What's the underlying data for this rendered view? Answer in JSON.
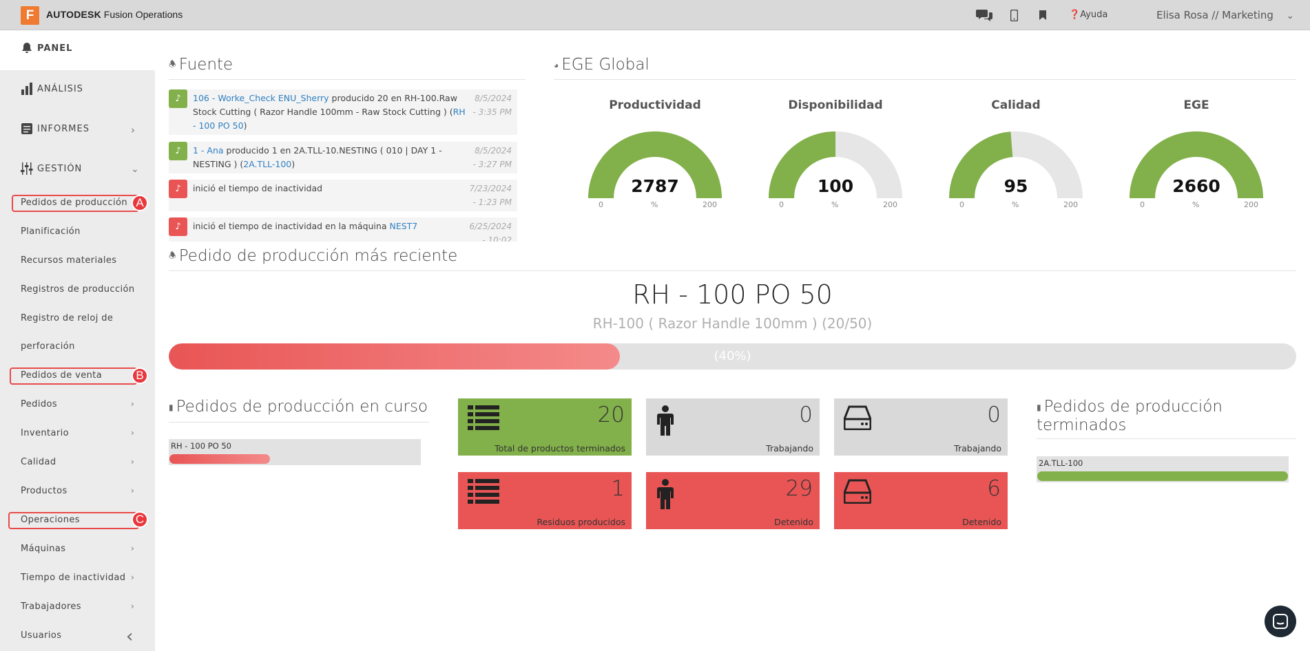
{
  "topbar": {
    "logo_letter": "F",
    "brand_bold": "AUTODESK",
    "brand_rest": "Fusion Operations",
    "help": "Ayuda",
    "user": "Elisa Rosa // Marketing",
    "icons": [
      "chat-icon",
      "mobile-icon",
      "bookmark-icon",
      "help-icon",
      "chevron-down-icon"
    ]
  },
  "sidebar": {
    "panel": "PANEL",
    "analisis": "ANÁLISIS",
    "informes": "INFORMES",
    "gestion": "GESTIÓN",
    "items": [
      {
        "label": "Pedidos de producción",
        "chevron": false
      },
      {
        "label": "Planificación",
        "chevron": false
      },
      {
        "label": "Recursos materiales",
        "chevron": false
      },
      {
        "label": "Registros de producción",
        "chevron": false
      },
      {
        "label": "Registro de reloj de",
        "chevron": false
      },
      {
        "label": "perforación",
        "chevron": false
      },
      {
        "label": "Pedidos de venta",
        "chevron": false
      },
      {
        "label": "Pedidos",
        "chevron": true
      },
      {
        "label": "Inventario",
        "chevron": true
      },
      {
        "label": "Calidad",
        "chevron": true
      },
      {
        "label": "Productos",
        "chevron": true
      },
      {
        "label": "Operaciones",
        "chevron": false
      },
      {
        "label": "Máquinas",
        "chevron": true
      },
      {
        "label": "Tiempo de inactividad",
        "chevron": true
      },
      {
        "label": "Trabajadores",
        "chevron": true
      },
      {
        "label": "Usuarios",
        "chevron": false
      }
    ],
    "badges": [
      "A",
      "B",
      "C"
    ]
  },
  "feed": {
    "title": "Fuente",
    "items": [
      {
        "status": "green",
        "link1": "106 - Worke_Check ENU_Sherry",
        "text1": " producido 20 en RH-100.Raw Stock Cutting ( Razor Handle 100mm - Raw Stock Cutting ) (",
        "link2": "RH - 100 PO 50",
        "text2": ")",
        "date": "8/5/2024",
        "time": "- 3:35 PM"
      },
      {
        "status": "green",
        "link1": "1 - Ana",
        "text1": " producido 1 en 2A.TLL-10.NESTING ( 010 | DAY 1 - NESTING ) (",
        "link2": "2A.TLL-100",
        "text2": ")",
        "date": "8/5/2024",
        "time": "- 3:27 PM"
      },
      {
        "status": "red",
        "link1": "",
        "text1": "inició el tiempo de inactividad",
        "link2": "",
        "text2": "",
        "date": "7/23/2024",
        "time": "- 1:23 PM"
      },
      {
        "status": "red",
        "link1": "",
        "text1": "inició el tiempo de inactividad en la máquina ",
        "link2": "NEST7",
        "text2": "",
        "date": "6/25/2024",
        "time": "- 10:02"
      }
    ]
  },
  "oee": {
    "title": "EGE Global",
    "gauges": [
      {
        "title": "Productividad",
        "value": "2787",
        "fill": 1.0,
        "min": "0",
        "max": "200",
        "unit": "%"
      },
      {
        "title": "Disponibilidad",
        "value": "100",
        "fill": 0.5,
        "min": "0",
        "max": "200",
        "unit": "%"
      },
      {
        "title": "Calidad",
        "value": "95",
        "fill": 0.475,
        "min": "0",
        "max": "200",
        "unit": "%"
      },
      {
        "title": "EGE",
        "value": "2660",
        "fill": 1.0,
        "min": "0",
        "max": "200",
        "unit": "%"
      }
    ]
  },
  "recent": {
    "title": "Pedido de producción más reciente",
    "code": "RH - 100 PO 50",
    "desc": "RH-100 ( Razor Handle 100mm ) (20/50)",
    "progress": 0.4,
    "progress_label": "(40%)"
  },
  "in_progress": {
    "title": "Pedidos de producción en curso",
    "items": [
      {
        "label": "RH - 100 PO 50",
        "progress": 0.4
      }
    ]
  },
  "tiles": [
    {
      "value": "20",
      "caption": "Total de productos terminados",
      "color": "#82b04a",
      "icon": "list-icon"
    },
    {
      "value": "0",
      "caption": "Trabajando",
      "color": "#d9d9d9",
      "icon": "person-icon"
    },
    {
      "value": "0",
      "caption": "Trabajando",
      "color": "#d9d9d9",
      "icon": "machine-icon"
    },
    {
      "value": "1",
      "caption": "Residuos producidos",
      "color": "#e95555",
      "icon": "list-icon"
    },
    {
      "value": "29",
      "caption": "Detenido",
      "color": "#e95555",
      "icon": "person-icon"
    },
    {
      "value": "6",
      "caption": "Detenido",
      "color": "#e95555",
      "icon": "machine-icon"
    }
  ],
  "finished": {
    "title_line1": "Pedidos de producción",
    "title_line2": "terminados",
    "items": [
      {
        "label": "2A.TLL-100",
        "progress": 1.0
      }
    ]
  },
  "colors": {
    "green": "#82b04a",
    "red": "#e95555",
    "gauge_bg": "#e6e6e6"
  }
}
